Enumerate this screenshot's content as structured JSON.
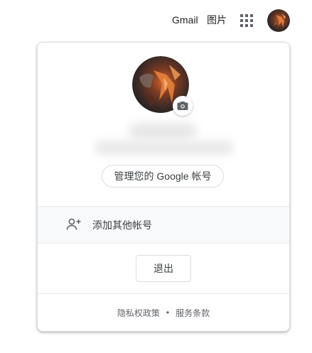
{
  "topbar": {
    "gmail_label": "Gmail",
    "images_label": "图片",
    "apps_icon": "apps-grid-icon",
    "avatar_icon": "account-avatar"
  },
  "account_card": {
    "manage_account_label": "管理您的 Google 帐号",
    "camera_icon": "camera-icon",
    "add_account_icon": "person-add-icon",
    "add_account_label": "添加其他帐号",
    "signout_label": "退出",
    "footer": {
      "privacy_label": "隐私权政策",
      "separator": "•",
      "terms_label": "服务条款"
    }
  },
  "colors": {
    "text_primary": "#202124",
    "text_secondary": "#5f6368",
    "border": "#dadce0",
    "row_background": "#f8f9fa",
    "icon_grey": "#5f6368"
  }
}
